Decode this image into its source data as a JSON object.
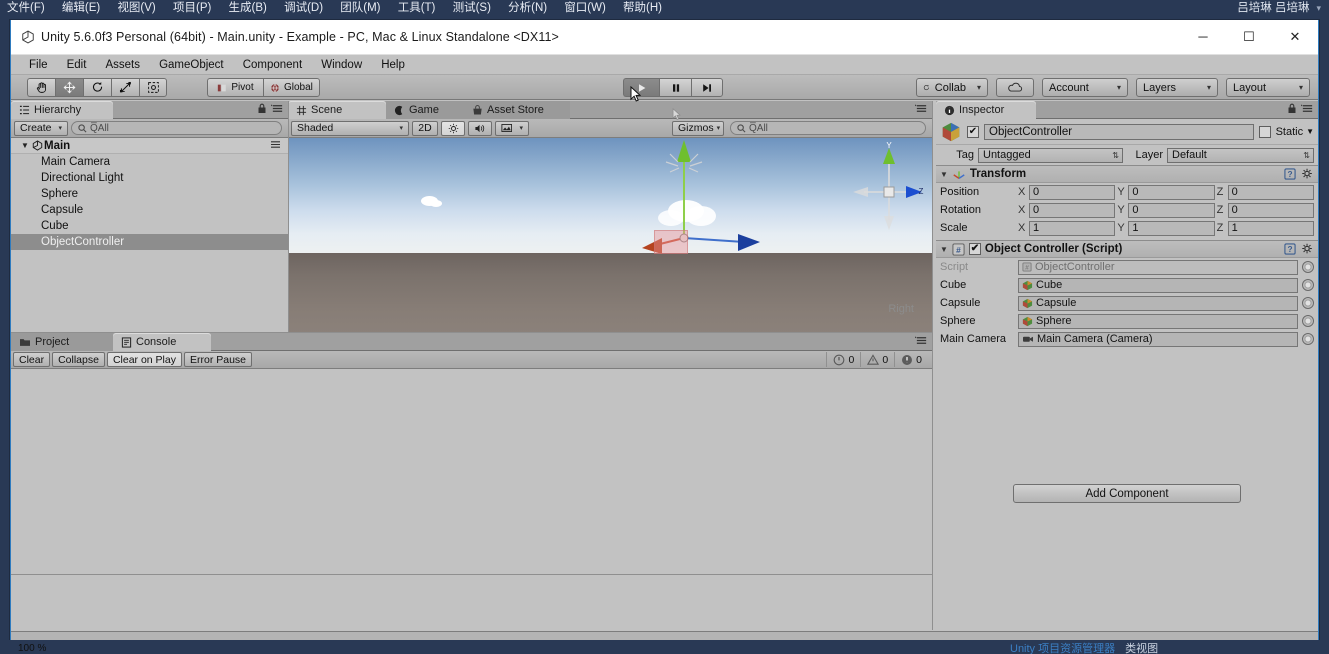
{
  "vs": {
    "menu": [
      "文件(F)",
      "编辑(E)",
      "视图(V)",
      "项目(P)",
      "生成(B)",
      "调试(D)",
      "团队(M)",
      "工具(T)",
      "测试(S)",
      "分析(N)",
      "窗口(W)",
      "帮助(H)"
    ],
    "user": "吕培琳 吕培琳",
    "user_caret": "▾",
    "zoom": "100 %",
    "bottom_tabs": {
      "primary": "Unity 项目资源管理器",
      "secondary": "类视图"
    }
  },
  "unity": {
    "title": "Unity 5.6.0f3 Personal (64bit) - Main.unity - Example - PC, Mac & Linux Standalone <DX11>",
    "window_buttons": {
      "minimize": "─",
      "maximize": "☐",
      "close": "✕"
    },
    "menu": [
      "File",
      "Edit",
      "Assets",
      "GameObject",
      "Component",
      "Window",
      "Help"
    ],
    "toolbar": {
      "tools": [
        {
          "name": "hand-tool",
          "glyph": "✋",
          "active": false
        },
        {
          "name": "move-tool",
          "glyph": "✥",
          "active": true
        },
        {
          "name": "rotate-tool",
          "glyph": "↻",
          "active": false
        },
        {
          "name": "scale-tool",
          "glyph": "⤡",
          "active": false
        },
        {
          "name": "rect-tool",
          "glyph": "▣",
          "active": false
        }
      ],
      "pivot_label": "Pivot",
      "global_label": "Global",
      "play_label": "▶",
      "pause_label": "⏸",
      "step_label": "▶|",
      "collab_label": "Collab",
      "cloud_label": "☁",
      "account_label": "Account",
      "layers_label": "Layers",
      "layout_label": "Layout",
      "dropdown_caret": "▾"
    }
  },
  "hierarchy": {
    "tab_label": "Hierarchy",
    "create_label": "Create",
    "create_caret": "▾",
    "search_placeholder": "Q̅All",
    "search_value": "",
    "root": "Main",
    "items": [
      {
        "label": "Main Camera",
        "selected": false
      },
      {
        "label": "Directional Light",
        "selected": false
      },
      {
        "label": "Sphere",
        "selected": false
      },
      {
        "label": "Capsule",
        "selected": false
      },
      {
        "label": "Cube",
        "selected": false
      },
      {
        "label": "ObjectController",
        "selected": true
      }
    ]
  },
  "scene": {
    "tabs": [
      {
        "label": "Scene",
        "active": true
      },
      {
        "label": "Game",
        "active": false
      },
      {
        "label": "Asset Store",
        "active": false
      }
    ],
    "shading_mode": "Shaded",
    "mode_2d": "2D",
    "lighting_icon": "☀",
    "audio_icon": "ὐA",
    "fx_icon": "▣",
    "gizmos_label": "Gizmos",
    "search_placeholder": "Q̅All",
    "orientation_label": "Right",
    "axis_y": "Y",
    "axis_z": "Z"
  },
  "inspector": {
    "tab_label": "Inspector",
    "object_name": "ObjectController",
    "enabled": true,
    "static_label": "Static",
    "static_checked": false,
    "tag_label": "Tag",
    "tag_value": "Untagged",
    "layer_label": "Layer",
    "layer_value": "Default",
    "transform": {
      "title": "Transform",
      "rows": [
        {
          "name": "Position",
          "x": "0",
          "y": "0",
          "z": "0"
        },
        {
          "name": "Rotation",
          "x": "0",
          "y": "0",
          "z": "0"
        },
        {
          "name": "Scale",
          "x": "1",
          "y": "1",
          "z": "1"
        }
      ],
      "axis_labels": [
        "X",
        "Y",
        "Z"
      ]
    },
    "script_component": {
      "title": "Object Controller (Script)",
      "enabled": true,
      "fields": [
        {
          "name": "Script",
          "value": "ObjectController",
          "dim": true,
          "icon": "script"
        },
        {
          "name": "Cube",
          "value": "Cube",
          "dim": false,
          "icon": "prefab"
        },
        {
          "name": "Capsule",
          "value": "Capsule",
          "dim": false,
          "icon": "prefab"
        },
        {
          "name": "Sphere",
          "value": "Sphere",
          "dim": false,
          "icon": "prefab"
        },
        {
          "name": "Main Camera",
          "value": "Main Camera (Camera)",
          "dim": false,
          "icon": "camera"
        }
      ]
    },
    "add_component_label": "Add Component"
  },
  "console": {
    "tabs": [
      {
        "label": "Project",
        "active": false
      },
      {
        "label": "Console",
        "active": true
      }
    ],
    "buttons": [
      {
        "label": "Clear",
        "toggled": false
      },
      {
        "label": "Collapse",
        "toggled": false
      },
      {
        "label": "Clear on Play",
        "toggled": true
      },
      {
        "label": "Error Pause",
        "toggled": false
      }
    ],
    "counts": [
      {
        "type": "info",
        "value": "0"
      },
      {
        "type": "warning",
        "value": "0"
      },
      {
        "type": "error",
        "value": "0"
      }
    ],
    "messages": []
  }
}
